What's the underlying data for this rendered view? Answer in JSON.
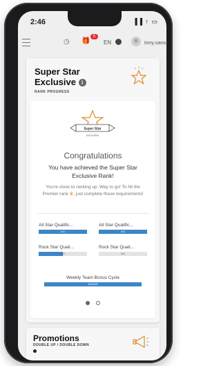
{
  "status_bar": {
    "time": "2:46",
    "system_icons": "▐▐ ↑ ▭"
  },
  "topbar": {
    "notification_count": "5",
    "language": "EN",
    "username": "tony.sans ⌄"
  },
  "rank_card": {
    "title_line1": "Super Star",
    "title_line2": "Exclusive",
    "info_glyph": "i",
    "subtitle": "RANK PROGRESS",
    "emblem_title": "Super Star",
    "emblem_sub": "EXCLUSIVE",
    "congrats": "Congratulations",
    "achieved": "You have achieved the Super Star Exclusive Rank!",
    "close_msg_1": "You're close to ranking up. Way to go! To hit the Premier rank",
    "close_msg_2": ", just complete these requirements!",
    "qualifications": [
      {
        "label": "All Star Qualific...",
        "value_text": "4/4",
        "progress": 1.0
      },
      {
        "label": "All Star Qualific...",
        "value_text": "4/4",
        "progress": 1.0
      },
      {
        "label": "Rock Star Quali...",
        "value_text": "1/2",
        "progress": 0.5
      },
      {
        "label": "Rock Star Quali...",
        "value_text": "0/1",
        "progress": 0.0
      }
    ],
    "weekly_label": "Weekly Team Bonus Cycle",
    "weekly_value": "300/300",
    "weekly_progress": 1.0
  },
  "promotions": {
    "title": "Promotions",
    "subtitle": "DOUBLE UP / DOUBLE DOWN"
  },
  "colors": {
    "accent": "#3d86c8",
    "badge": "#e0313a",
    "crown": "#e08a2c"
  }
}
